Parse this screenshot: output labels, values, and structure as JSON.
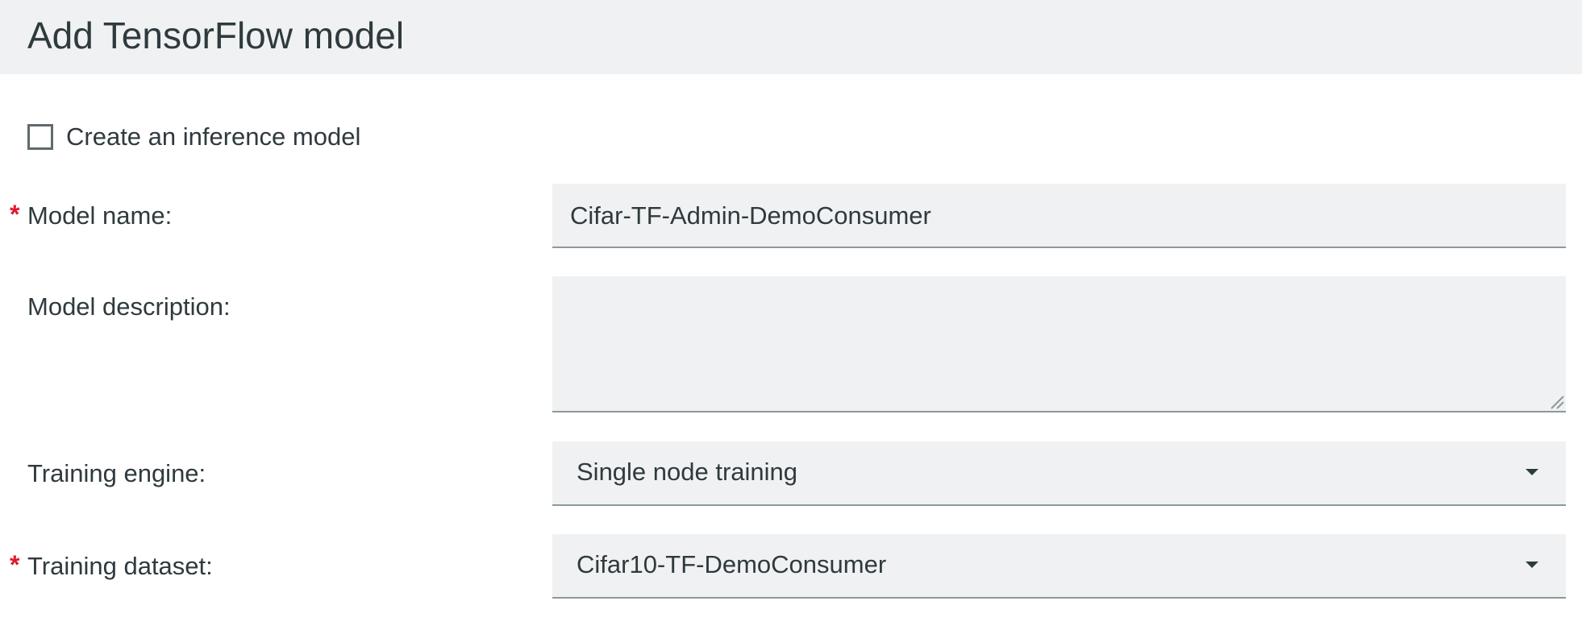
{
  "header": {
    "title": "Add TensorFlow model"
  },
  "inference_checkbox": {
    "label": "Create an inference model",
    "checked": false
  },
  "form": {
    "model_name": {
      "required": true,
      "label": "Model name:",
      "value": "Cifar-TF-Admin-DemoConsumer"
    },
    "model_description": {
      "required": false,
      "label": "Model description:",
      "value": ""
    },
    "training_engine": {
      "required": false,
      "label": "Training engine:",
      "selected": "Single node training"
    },
    "training_dataset": {
      "required": true,
      "label": "Training dataset:",
      "selected": "Cifar10-TF-DemoConsumer"
    },
    "required_marker": "*"
  },
  "icons": {
    "dropdown": "chevron-down-icon",
    "resize": "resize-grip-icon"
  },
  "colors": {
    "header_bg": "#f0f1f2",
    "field_bg": "#f0f1f2",
    "required": "#e0182d",
    "text": "#2f3a3e"
  }
}
